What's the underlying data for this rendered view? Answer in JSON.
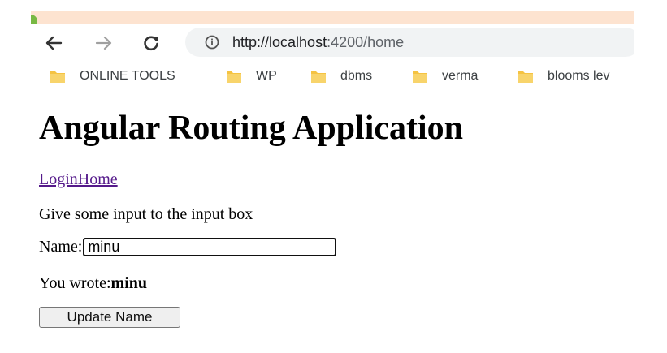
{
  "browser": {
    "url_host": "http://localhost",
    "url_path": ":4200/home",
    "bookmarks": [
      {
        "label": "ONLINE TOOLS",
        "icon": "folder-icon"
      },
      {
        "label": "WP",
        "icon": "folder-icon"
      },
      {
        "label": "dbms",
        "icon": "folder-icon"
      },
      {
        "label": "verma",
        "icon": "folder-icon"
      },
      {
        "label": "blooms lev",
        "icon": "folder-icon"
      }
    ],
    "icons": {
      "back": "back-arrow-icon",
      "forward": "forward-arrow-icon",
      "reload": "reload-icon",
      "info": "info-icon"
    },
    "colors": {
      "tabstrip": "#fde3d0",
      "omnibox": "#f1f3f4",
      "folder": "#f5c342"
    }
  },
  "page": {
    "title": "Angular Routing Application",
    "nav_link": "LoginHome",
    "prompt": "Give some input to the input box",
    "name_label": "Name:",
    "name_value": "minu",
    "wrote_label": "You wrote:",
    "wrote_value": "minu",
    "update_button": "Update Name"
  }
}
